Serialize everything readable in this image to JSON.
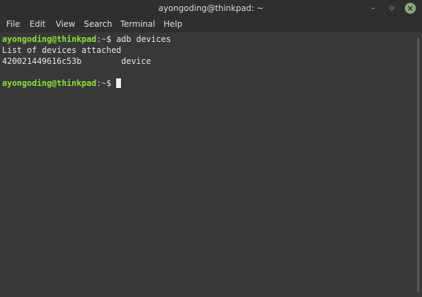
{
  "window": {
    "title": "ayongoding@thinkpad: ~",
    "minimize_glyph": "–",
    "maximize_glyph": "◇",
    "close_glyph": "×"
  },
  "menu": {
    "file": "File",
    "edit": "Edit",
    "view": "View",
    "search": "Search",
    "terminal": "Terminal",
    "help": "Help"
  },
  "terminal": {
    "prompt_user": "ayongoding@thinkpad",
    "prompt_sep": ":",
    "prompt_path": "~",
    "prompt_symbol": "$ ",
    "command": "adb devices",
    "output_line_1": "List of devices attached",
    "output_line_2": "420021449616c53b        device"
  },
  "colors": {
    "prompt_user": "#8ae234",
    "background": "#383838",
    "titlebar": "#2f2f2f",
    "close_button": "#8fa876"
  }
}
